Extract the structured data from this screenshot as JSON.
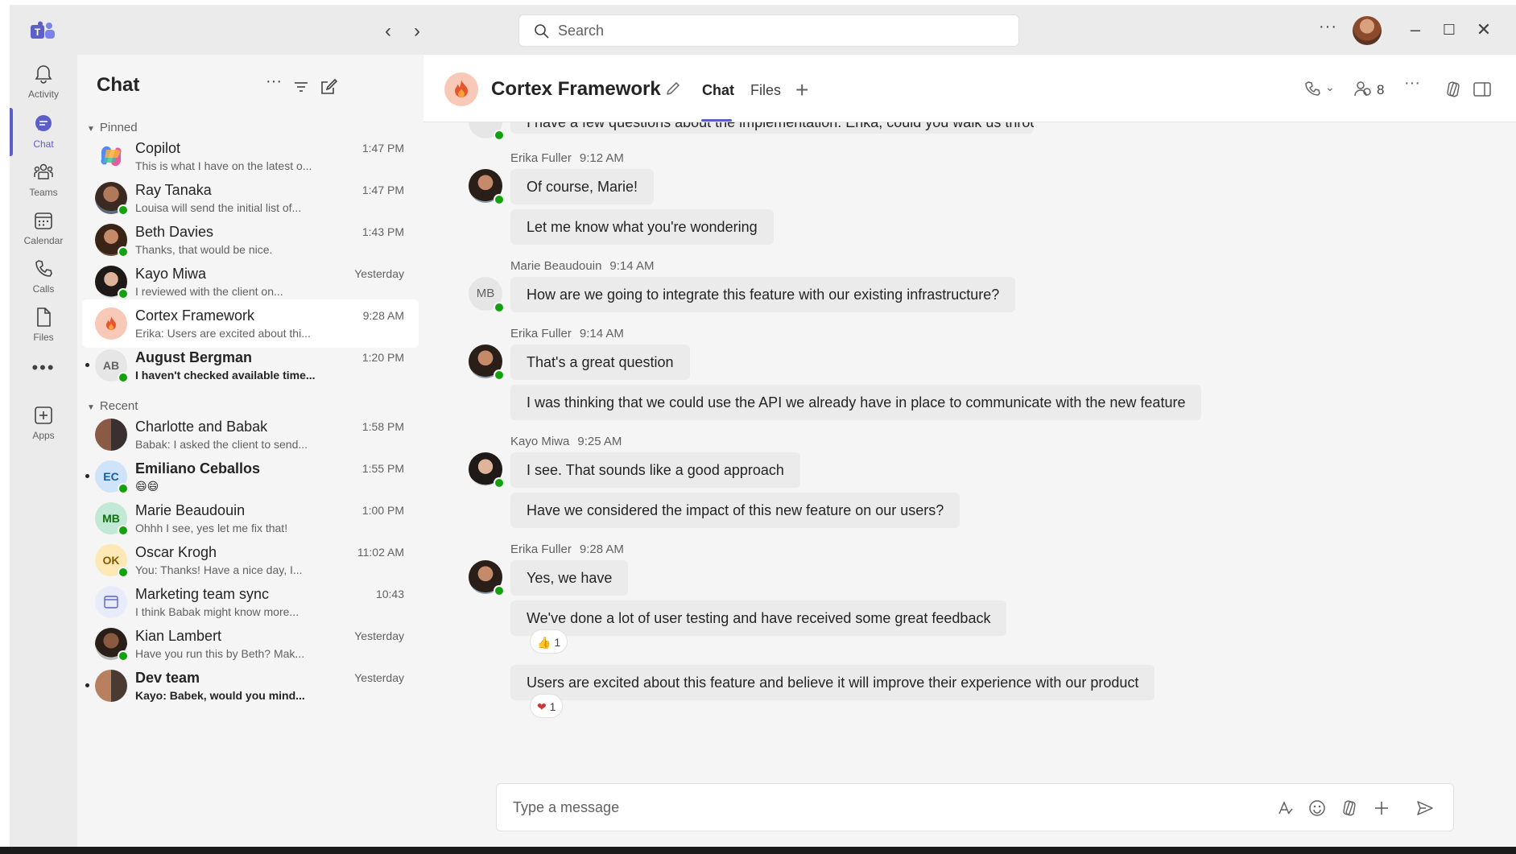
{
  "search": {
    "placeholder": "Search"
  },
  "rail": {
    "items": [
      {
        "label": "Activity",
        "icon": "bell-icon"
      },
      {
        "label": "Chat",
        "icon": "chat-icon"
      },
      {
        "label": "Teams",
        "icon": "teams-icon"
      },
      {
        "label": "Calendar",
        "icon": "calendar-icon"
      },
      {
        "label": "Calls",
        "icon": "phone-icon"
      },
      {
        "label": "Files",
        "icon": "file-icon"
      },
      {
        "label": "Apps",
        "icon": "add-app-icon"
      }
    ],
    "more": "•••"
  },
  "chatlist": {
    "title": "Chat",
    "pinned_label": "Pinned",
    "recent_label": "Recent",
    "pinned": [
      {
        "name": "Copilot",
        "preview": "This is what I have on the latest o...",
        "time": "1:47 PM"
      },
      {
        "name": "Ray Tanaka",
        "preview": "Louisa will send the initial list of...",
        "time": "1:47 PM"
      },
      {
        "name": "Beth Davies",
        "preview": "Thanks, that would be nice.",
        "time": "1:43 PM"
      },
      {
        "name": "Kayo Miwa",
        "preview": "I reviewed with the client on...",
        "time": "Yesterday"
      },
      {
        "name": "Cortex Framework",
        "preview": "Erika: Users are excited about thi...",
        "time": "9:28 AM"
      },
      {
        "name": "August Bergman",
        "preview": "I haven't checked available time...",
        "time": "1:20 PM",
        "initials": "AB"
      }
    ],
    "recent": [
      {
        "name": "Charlotte and Babak",
        "preview": "Babak: I asked the client to send...",
        "time": "1:58 PM"
      },
      {
        "name": "Emiliano Ceballos",
        "preview": "😄😄",
        "time": "1:55 PM",
        "initials": "EC"
      },
      {
        "name": "Marie Beaudouin",
        "preview": "Ohhh I see, yes let me fix that!",
        "time": "1:00 PM",
        "initials": "MB"
      },
      {
        "name": "Oscar Krogh",
        "preview": "You: Thanks! Have a nice day, I...",
        "time": "11:02 AM",
        "initials": "OK"
      },
      {
        "name": "Marketing team sync",
        "preview": "I think Babak might know more...",
        "time": "10:43"
      },
      {
        "name": "Kian Lambert",
        "preview": "Have you run this by Beth? Mak...",
        "time": "Yesterday"
      },
      {
        "name": "Dev team",
        "preview": "Kayo: Babek, would you mind...",
        "time": "Yesterday"
      }
    ]
  },
  "conversation": {
    "title": "Cortex Framework",
    "tabs": [
      "Chat",
      "Files"
    ],
    "participants": "8",
    "cut_message": "I have a few questions about the implementation. Erika, could you walk us through it?",
    "groups": [
      {
        "author": "Erika Fuller",
        "time": "9:12 AM",
        "messages": [
          "Of course, Marie!",
          "Let me know what you're wondering"
        ]
      },
      {
        "author": "Marie Beaudouin",
        "time": "9:14 AM",
        "initials": "MB",
        "messages": [
          "How are we going to integrate this feature with our existing infrastructure?"
        ]
      },
      {
        "author": "Erika Fuller",
        "time": "9:14 AM",
        "messages": [
          "That's a great question",
          "I was thinking that we could use the API we already have in place to communicate with the new feature"
        ]
      },
      {
        "author": "Kayo Miwa",
        "time": "9:25 AM",
        "messages": [
          "I see. That sounds like a good approach",
          "Have we considered the impact of this new feature on our users?"
        ]
      },
      {
        "author": "Erika Fuller",
        "time": "9:28 AM",
        "messages": [
          "Yes, we have",
          "We've done a lot of user testing and have received some great feedback",
          "Users are excited about this feature and believe it will improve their experience with our product"
        ]
      }
    ],
    "reactions": [
      {
        "emoji": "👍",
        "count": "1"
      },
      {
        "emoji": "❤",
        "count": "1"
      }
    ]
  },
  "composer": {
    "placeholder": "Type a message"
  },
  "colors": {
    "accent": "#5b5fc7",
    "presence": "#13a10e",
    "bubble": "#ebebeb"
  }
}
